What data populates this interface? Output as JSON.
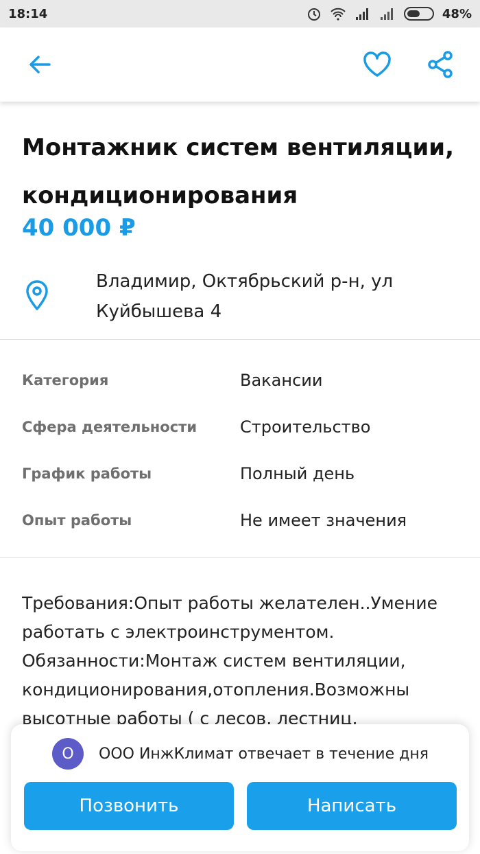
{
  "status_bar": {
    "time": "18:14",
    "battery": "48%"
  },
  "listing": {
    "title": "Монтажник систем вентиляции, кондиционирования",
    "price": "40 000 ₽",
    "address": "Владимир, Октябрьский р-н, ул Куйбышева 4"
  },
  "params": [
    {
      "key": "Категория",
      "value": "Вакансии"
    },
    {
      "key": "Сфера деятельности",
      "value": "Строительство"
    },
    {
      "key": "График работы",
      "value": "Полный день"
    },
    {
      "key": "Опыт работы",
      "value": "Не имеет значения"
    }
  ],
  "description": "Требования:Опыт работы желателен..Умение работать с электроинструментом. Обязанности:Монтаж систем вентиляции, кондиционирования,отопления.Возможны высотные работы ( с лесов, лестниц, автовышки)",
  "seller": {
    "avatar_letter": "О",
    "response_text": "ООО ИнжКлимат отвечает в течение дня"
  },
  "actions": {
    "call_label": "Позвонить",
    "write_label": "Написать"
  },
  "icons": {
    "back": "arrow-left-icon",
    "favorite": "heart-icon",
    "share": "share-icon",
    "location": "map-pin-icon"
  },
  "colors": {
    "accent": "#1a9be6",
    "button": "#1aa0ea",
    "avatar": "#5c5bc8"
  }
}
